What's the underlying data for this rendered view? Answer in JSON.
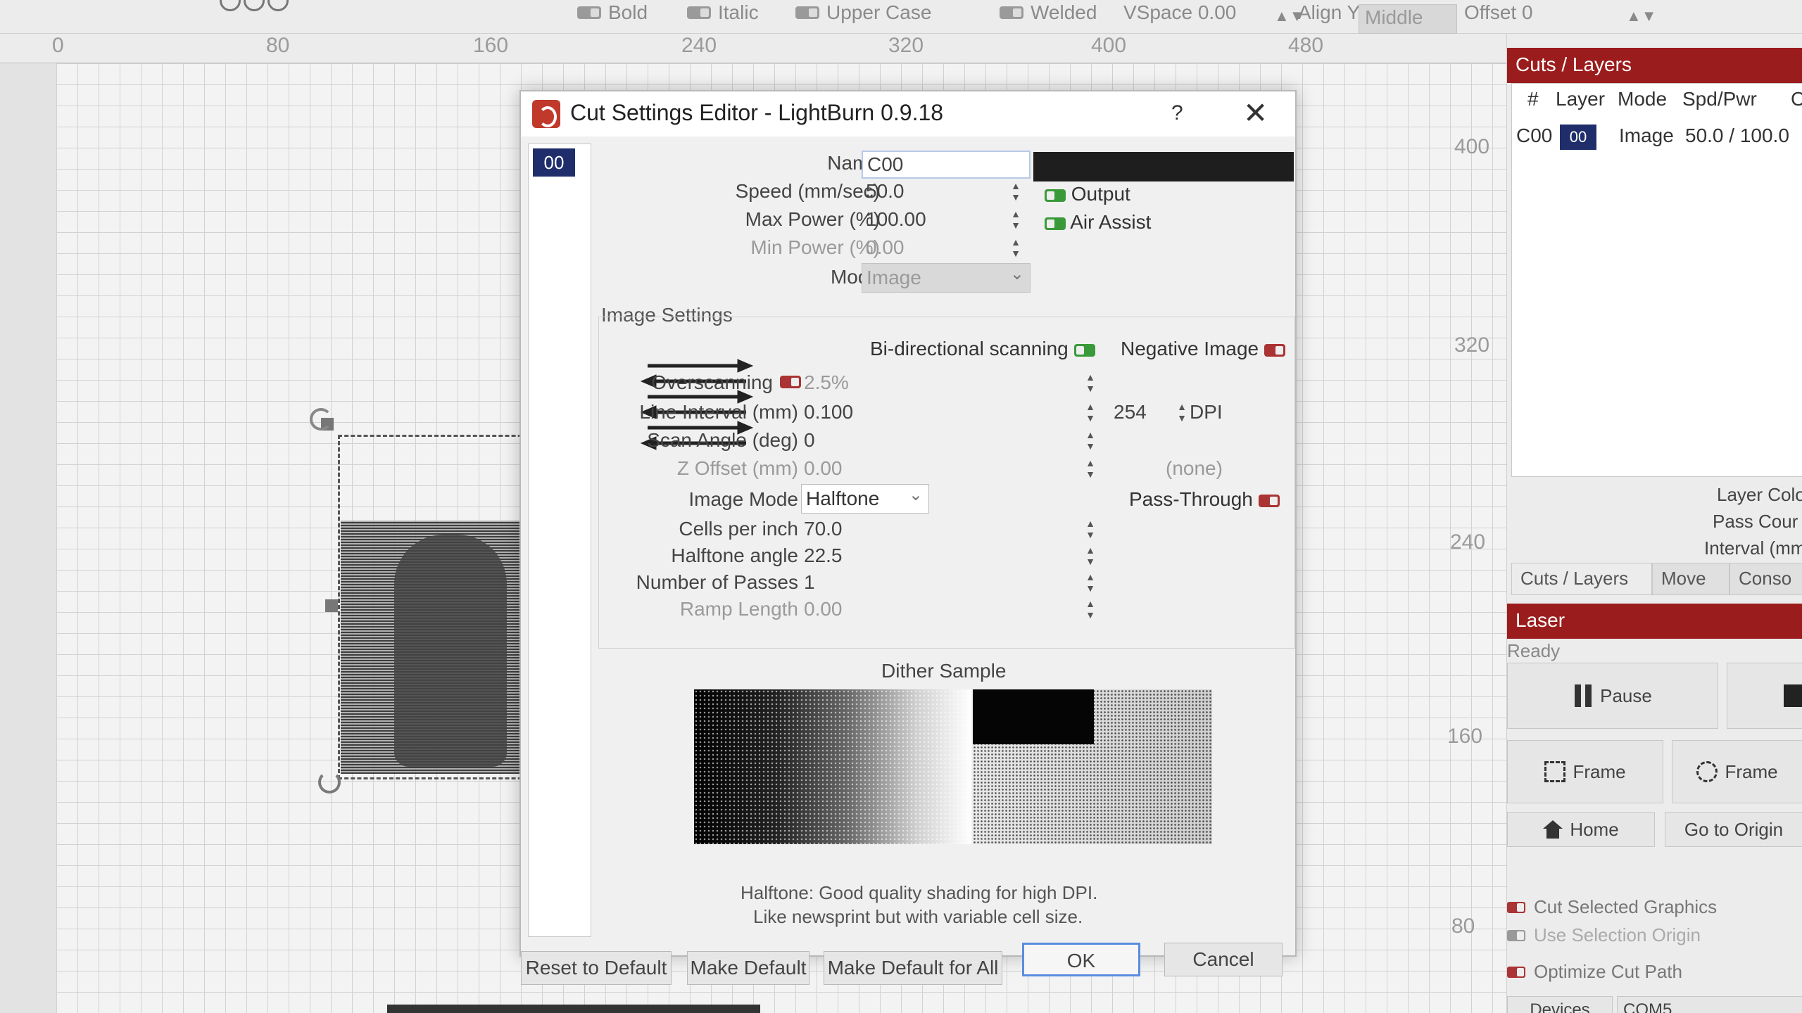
{
  "toolbar": {
    "bold": "Bold",
    "italic": "Italic",
    "upper_case": "Upper Case",
    "welded": "Welded",
    "vspace": "VSpace 0.00",
    "align_y": "Align Y",
    "align_y_value": "Middle",
    "offset": "Offset 0"
  },
  "ruler": {
    "labels": [
      "0",
      "80",
      "160",
      "240",
      "320",
      "400",
      "480"
    ],
    "side_labels": [
      "400",
      "320",
      "240",
      "160",
      "80"
    ]
  },
  "dialog": {
    "title": "Cut Settings Editor - LightBurn 0.9.18",
    "help": "?",
    "close": "✕",
    "layer_chip": "00",
    "name_label": "Name",
    "name_value": "C00",
    "speed_label": "Speed (mm/sec)",
    "speed_value": "50.0",
    "max_power_label": "Max Power (%)",
    "max_power_value": "100.00",
    "min_power_label": "Min Power (%)",
    "min_power_value": "0.00",
    "mode_label": "Mode",
    "mode_value": "Image",
    "output_label": "Output",
    "air_assist_label": "Air Assist",
    "image_settings": {
      "title": "Image Settings",
      "bidirectional_label": "Bi-directional scanning",
      "negative_label": "Negative Image",
      "overscanning_label": "Overscanning",
      "overscanning_value": "2.5%",
      "line_interval_label": "Line Interval (mm)",
      "line_interval_value": "0.100",
      "dpi_value": "254",
      "dpi_label": "DPI",
      "scan_angle_label": "Scan Angle (deg)",
      "scan_angle_value": "0",
      "z_offset_label": "Z Offset (mm)",
      "z_offset_value": "0.00",
      "none_label": "(none)",
      "image_mode_label": "Image Mode",
      "image_mode_value": "Halftone",
      "pass_through_label": "Pass-Through",
      "cells_label": "Cells per inch",
      "cells_value": "70.0",
      "halftone_angle_label": "Halftone angle",
      "halftone_angle_value": "22.5",
      "passes_label": "Number of Passes",
      "passes_value": "1",
      "ramp_label": "Ramp Length",
      "ramp_value": "0.00"
    },
    "dither_title": "Dither Sample",
    "dither_desc_1": "Halftone: Good quality shading for high DPI.",
    "dither_desc_2": "Like newsprint but with variable cell size.",
    "buttons": {
      "reset": "Reset to Default",
      "make_default": "Make Default",
      "make_default_all": "Make Default for All",
      "ok": "OK",
      "cancel": "Cancel"
    },
    "name_color": "#1e1e1e"
  },
  "right_panel": {
    "cuts_title": "Cuts / Layers",
    "columns": [
      "#",
      "Layer",
      "Mode",
      "Spd/Pwr",
      "C"
    ],
    "row": {
      "id": "C00",
      "layer": "00",
      "mode": "Image",
      "spd_pwr": "50.0 / 100.0"
    },
    "layer_color": "Layer Colo",
    "pass_count": "Pass Cour",
    "interval": "Interval (mm",
    "tabs": [
      "Cuts / Layers",
      "Move",
      "Conso"
    ],
    "laser_title": "Laser",
    "status": "Ready",
    "pause": "Pause",
    "frame1": "Frame",
    "frame2": "Frame",
    "home": "Home",
    "go_to_origin": "Go to Origin",
    "cut_selected": "Cut Selected Graphics",
    "use_selection": "Use Selection Origin",
    "optimize": "Optimize Cut Path",
    "devices": "Devices",
    "com": "COM5"
  },
  "colors": {
    "accent_red": "#9b1c1c",
    "layer_blue": "#1f2e6b",
    "toggle_on": "#3a9a3a",
    "toggle_off": "#a33333"
  }
}
